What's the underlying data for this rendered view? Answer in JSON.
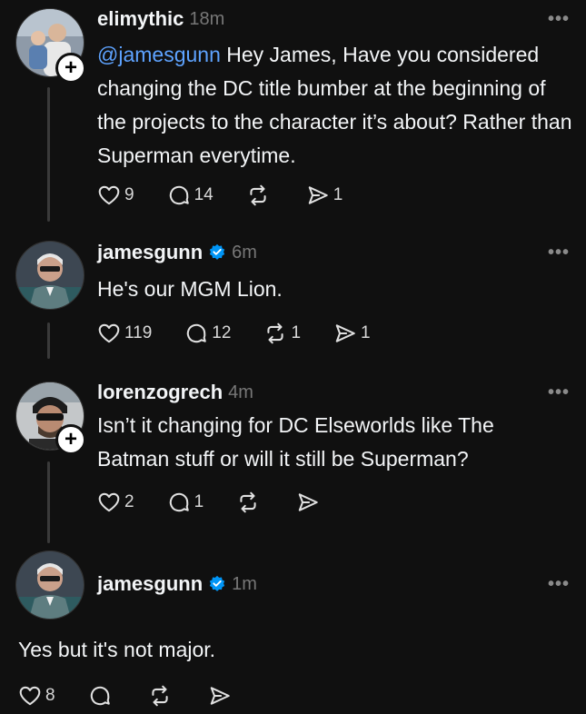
{
  "posts": [
    {
      "username": "elimythic",
      "time": "18m",
      "mention": "@jamesgunn",
      "text": " Hey James, Have you considered changing the DC title bumber at the beginning of the projects to the character it’s about? Rather than Superman everytime.",
      "likes": "9",
      "replies": "14",
      "reposts": "",
      "shares": "1"
    },
    {
      "username": "jamesgunn",
      "time": "6m",
      "text": "He's our MGM Lion.",
      "likes": "119",
      "replies": "12",
      "reposts": "1",
      "shares": "1"
    },
    {
      "username": "lorenzogrech",
      "time": "4m",
      "text": "Isn’t it changing for DC Elseworlds like The Batman stuff or will it still be Superman?",
      "likes": "2",
      "replies": "1",
      "reposts": "",
      "shares": ""
    },
    {
      "username": "jamesgunn",
      "time": "1m",
      "text": "Yes but it's not major.",
      "likes": "8",
      "replies": "",
      "reposts": "",
      "shares": ""
    }
  ],
  "more_label": "•••",
  "plus_label": "+",
  "colors": {
    "background": "#101010",
    "mention": "#5ea3ff",
    "verified": "#0095f6",
    "muted": "#777777"
  },
  "icons": [
    "heart-icon",
    "comment-icon",
    "repost-icon",
    "share-icon",
    "verified-badge-icon",
    "more-icon",
    "plus-icon"
  ]
}
